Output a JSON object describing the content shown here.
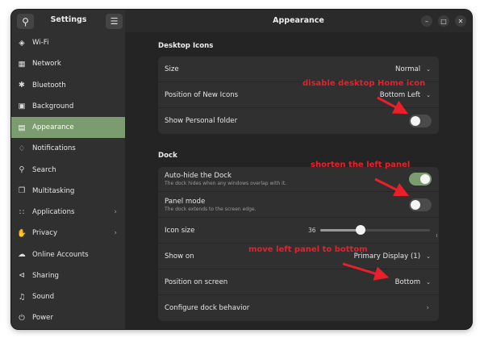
{
  "sidebar": {
    "title": "Settings",
    "search_icon": "search-icon",
    "menu_icon": "hamburger-menu-icon",
    "items": [
      {
        "label": "Wi-Fi",
        "icon": "wifi-icon"
      },
      {
        "label": "Network",
        "icon": "network-icon"
      },
      {
        "label": "Bluetooth",
        "icon": "bluetooth-icon"
      },
      {
        "label": "Background",
        "icon": "background-icon"
      },
      {
        "label": "Appearance",
        "icon": "appearance-icon",
        "active": true
      },
      {
        "label": "Notifications",
        "icon": "bell-icon"
      },
      {
        "label": "Search",
        "icon": "search-icon"
      },
      {
        "label": "Multitasking",
        "icon": "multitasking-icon"
      },
      {
        "label": "Applications",
        "icon": "apps-grid-icon",
        "has_submenu": true
      },
      {
        "label": "Privacy",
        "icon": "hand-icon",
        "has_submenu": true
      },
      {
        "label": "Online Accounts",
        "icon": "cloud-icon"
      },
      {
        "label": "Sharing",
        "icon": "share-icon"
      },
      {
        "label": "Sound",
        "icon": "music-note-icon"
      },
      {
        "label": "Power",
        "icon": "power-icon"
      }
    ]
  },
  "header": {
    "title": "Appearance",
    "minimize_icon": "minimize-icon",
    "maximize_icon": "maximize-icon",
    "close_icon": "close-icon"
  },
  "desktop_icons": {
    "title": "Desktop Icons",
    "size": {
      "label": "Size",
      "value": "Normal"
    },
    "position": {
      "label": "Position of New Icons",
      "value": "Bottom Left"
    },
    "personal_folder": {
      "label": "Show Personal folder",
      "enabled": false
    }
  },
  "dock": {
    "title": "Dock",
    "autohide": {
      "label": "Auto-hide the Dock",
      "description": "The dock hides when any windows overlap with it.",
      "enabled": true
    },
    "panel_mode": {
      "label": "Panel mode",
      "description": "The dock extends to the screen edge.",
      "enabled": false
    },
    "icon_size": {
      "label": "Icon size",
      "value": "36",
      "fraction": 0.37
    },
    "show_on": {
      "label": "Show on",
      "value": "Primary Display (1)"
    },
    "position": {
      "label": "Position on screen",
      "value": "Bottom"
    },
    "configure": {
      "label": "Configure dock behavior"
    }
  },
  "annotations": {
    "home_icon": "disable desktop Home icon",
    "left_panel": "shorten the left panel",
    "bottom": "move left panel to bottom",
    "color": "#e8202a"
  },
  "colors": {
    "accent": "#7b9c6f",
    "window_bg": "#242424",
    "sidebar_bg": "#303030"
  }
}
